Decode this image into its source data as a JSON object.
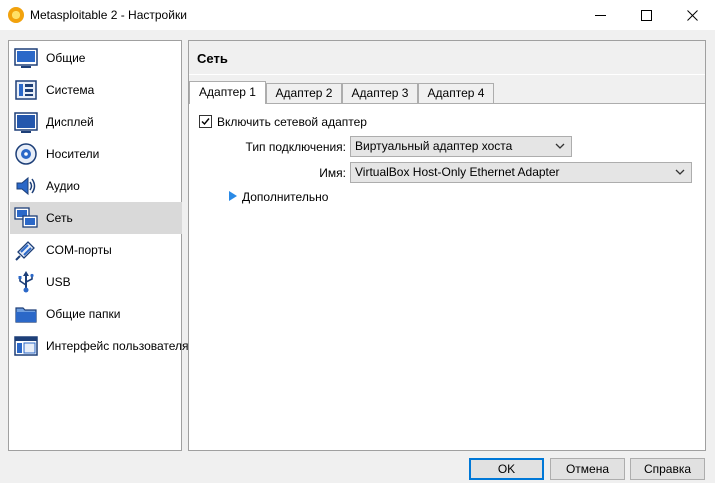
{
  "window": {
    "title": "Metasploitable 2 - Настройки",
    "minimize_glyph": "—",
    "maximize_glyph": "☐",
    "close_glyph": "✕"
  },
  "sidebar": {
    "items": [
      {
        "label": "Общие",
        "icon": "general-icon"
      },
      {
        "label": "Система",
        "icon": "system-icon"
      },
      {
        "label": "Дисплей",
        "icon": "display-icon"
      },
      {
        "label": "Носители",
        "icon": "storage-icon"
      },
      {
        "label": "Аудио",
        "icon": "audio-icon"
      },
      {
        "label": "Сеть",
        "icon": "network-icon",
        "selected": true
      },
      {
        "label": "COM-порты",
        "icon": "serial-ports-icon"
      },
      {
        "label": "USB",
        "icon": "usb-icon"
      },
      {
        "label": "Общие папки",
        "icon": "shared-folders-icon"
      },
      {
        "label": "Интерфейс пользователя",
        "icon": "user-interface-icon"
      }
    ]
  },
  "main": {
    "section_title": "Сеть",
    "tabs": [
      {
        "label": "Адаптер 1",
        "active": true
      },
      {
        "label": "Адаптер 2"
      },
      {
        "label": "Адаптер 3"
      },
      {
        "label": "Адаптер 4"
      }
    ],
    "enable_adapter": {
      "label": "Включить сетевой адаптер",
      "checked": true
    },
    "attached_to": {
      "label": "Тип подключения:",
      "value": "Виртуальный адаптер хоста"
    },
    "name": {
      "label": "Имя:",
      "value": "VirtualBox Host-Only Ethernet Adapter"
    },
    "advanced": {
      "label": "Дополнительно",
      "expanded": false
    }
  },
  "footer": {
    "ok_label": "OK",
    "cancel_label": "Отмена",
    "help_label": "Справка"
  },
  "colors": {
    "accent": "#0078d7",
    "selection": "#d9d9d9"
  }
}
